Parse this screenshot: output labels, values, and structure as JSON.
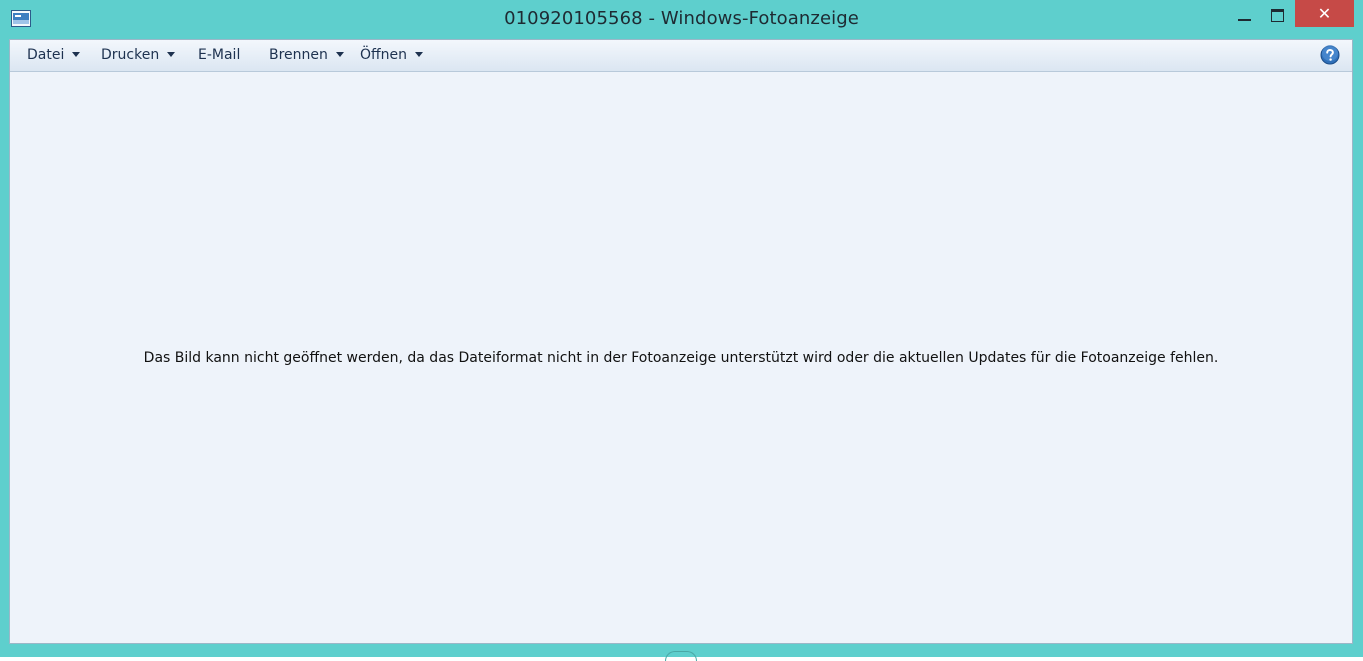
{
  "window": {
    "title": "010920105568 - Windows-Fotoanzeige",
    "close_symbol": "✕",
    "app_icon": "photo-viewer-icon"
  },
  "menu": {
    "items": [
      {
        "label": "Datei",
        "has_dropdown": true
      },
      {
        "label": "Drucken",
        "has_dropdown": true
      },
      {
        "label": "E-Mail",
        "has_dropdown": false
      },
      {
        "label": "Brennen",
        "has_dropdown": true
      },
      {
        "label": "Öffnen",
        "has_dropdown": true
      }
    ],
    "help_icon": "help-icon"
  },
  "content": {
    "message": "Das Bild kann nicht geöffnet werden, da das Dateiformat nicht in der Fotoanzeige unterstützt wird oder die aktuellen Updates für die Fotoanzeige fehlen."
  },
  "colors": {
    "frame": "#5ecfcd",
    "close_button": "#c64a47",
    "client_background": "#eef3fa"
  }
}
